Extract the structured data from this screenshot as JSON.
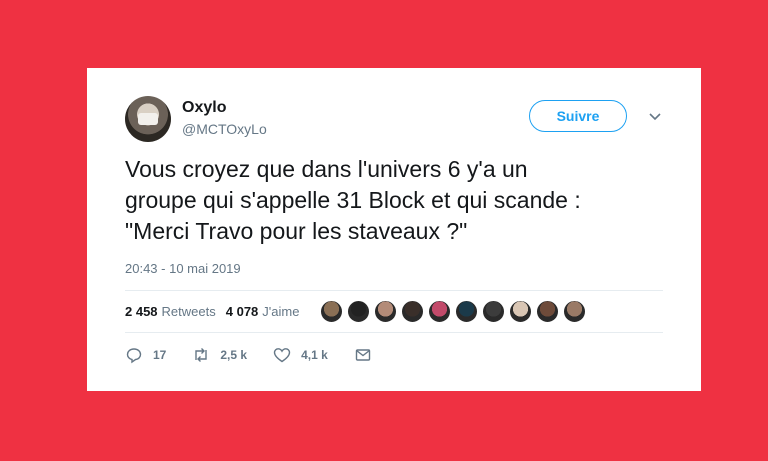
{
  "tweet": {
    "display_name": "Oxylo",
    "handle": "@MCTOxyLo",
    "follow_label": "Suivre",
    "text": "Vous croyez que dans l'univers 6 y'a un\ngroupe qui s'appelle 31 Block et qui scande :\n\"Merci Travo pour les staveaux ?\"",
    "timestamp": "20:43 - 10 mai 2019",
    "retweets_count": "2 458",
    "retweets_label": "Retweets",
    "likes_count": "4 078",
    "likes_label": "J'aime",
    "replies": "17",
    "retweets_short": "2,5 k",
    "likes_short": "4,1 k"
  },
  "icons": [
    "chevron-down-icon",
    "reply-icon",
    "retweet-icon",
    "like-icon",
    "message-icon"
  ],
  "colors": {
    "background": "#ef3142",
    "card": "#ffffff",
    "accent": "#1da1f2",
    "secondary_text": "#657786"
  },
  "likers": [
    "#8a6f55",
    "#222222",
    "#b38b78",
    "#3a2f2a",
    "#c24a6a",
    "#1b3a4a",
    "#3c3c3c",
    "#d9c6b4",
    "#6e4b3a",
    "#9a7a66"
  ]
}
